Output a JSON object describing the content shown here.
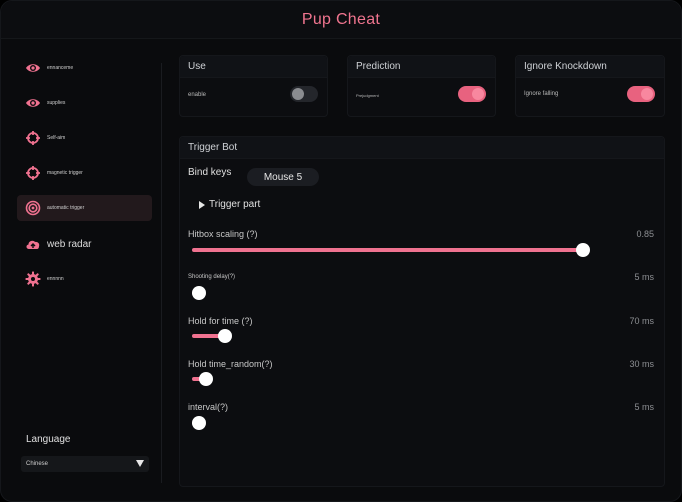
{
  "app": {
    "title": "Pup Cheat"
  },
  "sidebar": {
    "items": [
      {
        "label": "ennanceme",
        "icon": "eye-icon"
      },
      {
        "label": "supplies",
        "icon": "eye-icon"
      },
      {
        "label": "Self-aim",
        "icon": "crosshair-icon"
      },
      {
        "label": "magnetic trigger",
        "icon": "crosshair-icon"
      },
      {
        "label": "automatic trigger",
        "icon": "target-icon",
        "active": true
      },
      {
        "label": "web radar",
        "icon": "cloud-upload-icon"
      },
      {
        "label": "ennnnn",
        "icon": "gear-icon"
      }
    ],
    "language": {
      "title": "Language",
      "selected": "Chinese"
    }
  },
  "panels": {
    "use": {
      "title": "Use",
      "label": "enable",
      "on": false
    },
    "prediction": {
      "title": "Prediction",
      "label": "Prejudgment",
      "on": true
    },
    "ignore_knockdown": {
      "title": "Ignore Knockdown",
      "label": "Ignore falling",
      "on": true
    }
  },
  "trigger_bot": {
    "title": "Trigger Bot",
    "bind_keys_label": "Bind keys",
    "bind_key": "Mouse 5",
    "trigger_part_label": "Trigger part",
    "sliders": [
      {
        "label": "Hitbox scaling (?)",
        "value": "0.85",
        "fraction": 0.84
      },
      {
        "label": "Shooting delay(?)",
        "value": "5 ms",
        "fraction": 0.005
      },
      {
        "label": "Hold for time (?)",
        "value": "70 ms",
        "fraction": 0.07
      },
      {
        "label": "Hold time_random(?)",
        "value": "30 ms",
        "fraction": 0.03
      },
      {
        "label": "interval(?)",
        "value": "5 ms",
        "fraction": 0.005
      }
    ]
  },
  "colors": {
    "accent": "#f07290",
    "title": "#f0758f",
    "background": "#0a0b0d"
  }
}
